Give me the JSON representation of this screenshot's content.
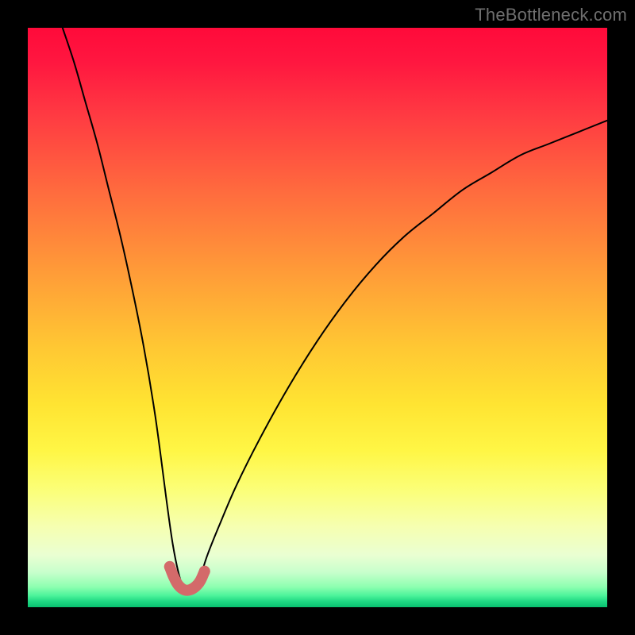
{
  "watermark": "TheBottleneck.com",
  "colors": {
    "frame": "#000000",
    "curve": "#000000",
    "stub": "#d36a6a"
  },
  "chart_data": {
    "type": "line",
    "title": "",
    "xlabel": "",
    "ylabel": "",
    "xlim": [
      0,
      100
    ],
    "ylim": [
      0,
      100
    ],
    "grid": false,
    "legend": false,
    "notes": "Black V-curve on rainbow gradient; minimum near x≈27. No axis ticks or labels shown. Values estimated from pixel positions.",
    "series": [
      {
        "name": "bottleneck-curve",
        "color": "#000000",
        "x": [
          6,
          8,
          10,
          12,
          14,
          16,
          18,
          20,
          22,
          24,
          25,
          26,
          27,
          28,
          29,
          30,
          31,
          33,
          36,
          40,
          45,
          50,
          55,
          60,
          65,
          70,
          75,
          80,
          85,
          90,
          95,
          100
        ],
        "y": [
          100,
          94,
          87,
          80,
          72,
          64,
          55,
          45,
          33,
          18,
          11,
          6,
          3,
          3,
          4,
          6,
          9,
          14,
          21,
          29,
          38,
          46,
          53,
          59,
          64,
          68,
          72,
          75,
          78,
          80,
          82,
          84
        ]
      },
      {
        "name": "highlight-stub",
        "color": "#d36a6a",
        "x": [
          24.5,
          25.2,
          26.0,
          27.0,
          28.0,
          29.0,
          29.8,
          30.5
        ],
        "y": [
          7.0,
          5.2,
          3.8,
          3.0,
          3.0,
          3.6,
          4.6,
          6.2
        ]
      }
    ]
  }
}
